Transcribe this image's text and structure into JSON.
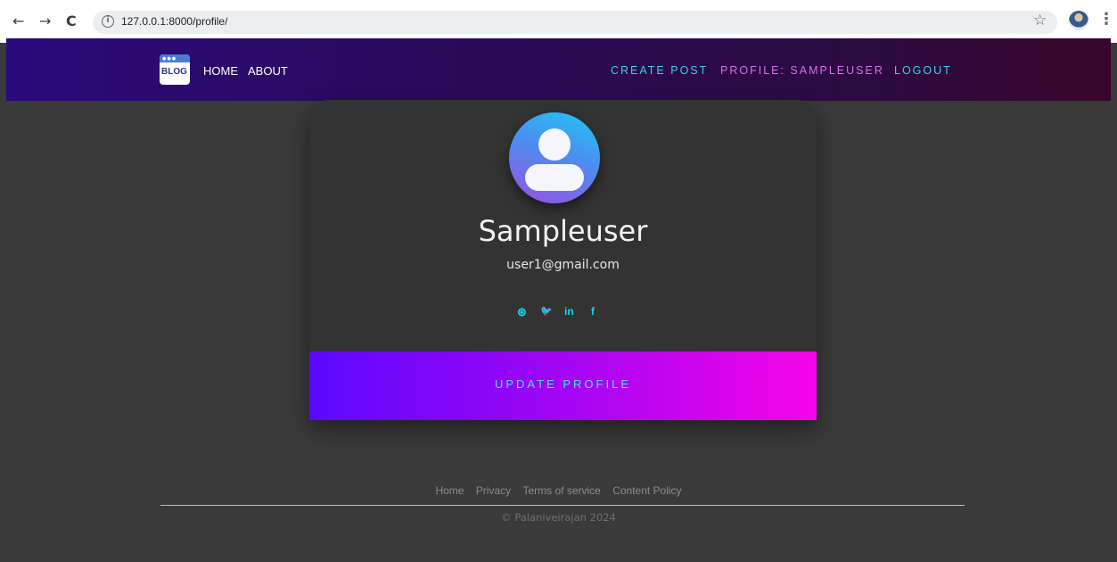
{
  "browser": {
    "back_glyph": "←",
    "forward_glyph": "→",
    "reload_glyph": "C",
    "info_glyph": "i",
    "url": "127.0.0.1:8000/profile/",
    "star_glyph": "☆",
    "menu_glyph": "⋮"
  },
  "navbar": {
    "logo_text": "BLOG",
    "links": [
      "HOME",
      "ABOUT"
    ],
    "right_links": [
      {
        "label": "CREATE POST",
        "color": "#3ad0e8"
      },
      {
        "label": "PROFILE: SAMPLEUSER",
        "color": "#d66fe6"
      },
      {
        "label": "LOGOUT",
        "color": "#3ad0e8"
      }
    ],
    "gradient_start": "#2a0a7a",
    "gradient_end": "#38052a"
  },
  "profile": {
    "username": "Sampleuser",
    "email": "user1@gmail.com",
    "social_icons": [
      "dribbble-icon",
      "twitter-icon",
      "linkedin-icon",
      "facebook-icon"
    ],
    "social_glyphs": [
      "⊛",
      "🐦",
      "in",
      "f"
    ],
    "update_button": "UPDATE PROFILE",
    "accent_color": "#12d4f5"
  },
  "footer": {
    "links": [
      "Home",
      "Privacy",
      "Terms of service",
      "Content Policy"
    ],
    "copyright": "© Palaniveirajan 2024"
  }
}
